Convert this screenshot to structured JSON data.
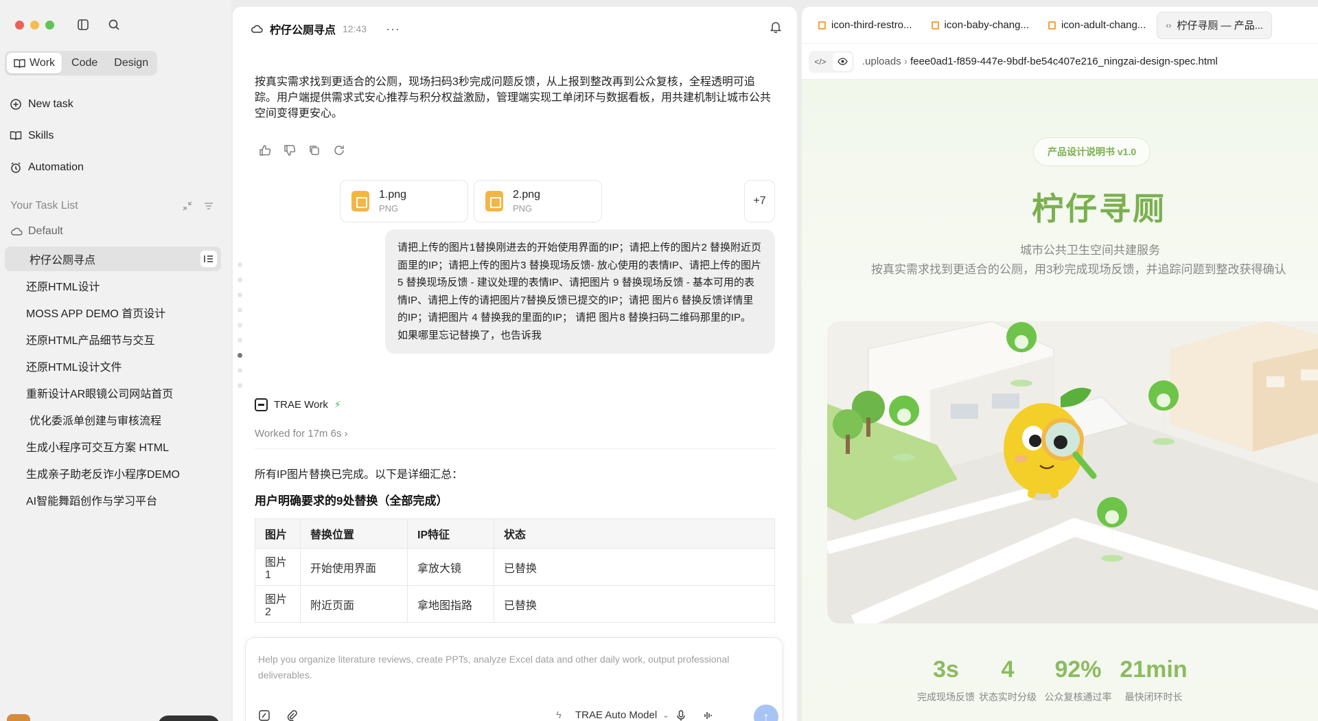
{
  "sidebar": {
    "modes": [
      "Work",
      "Code",
      "Design"
    ],
    "active_mode": "Work",
    "nav": {
      "new_task": "New task",
      "skills": "Skills",
      "automation": "Automation"
    },
    "tasklist_header": "Your Task List",
    "group": "Default",
    "tasks": [
      "柠仔公厕寻点",
      "还原HTML设计",
      "MOSS APP DEMO 首页设计",
      "还原HTML产品细节与交互",
      "还原HTML设计文件",
      "重新设计AR眼镜公司网站首页",
      "优化委派单创建与审核流程",
      "生成小程序可交互方案 HTML",
      "生成亲子助老反诈小程序DEMO",
      "AI智能舞蹈创作与学习平台"
    ]
  },
  "chat": {
    "title": "柠仔公厕寻点",
    "time": "12:43",
    "more": "···",
    "assistant_intro": "按真实需求找到更适合的公厕，现场扫码3秒完成问题反馈，从上报到整改再到公众复核，全程透明可追踪。用户端提供需求式安心推荐与积分权益激励，管理端实现工单闭环与数据看板，用共建机制让城市公共空间变得更安心。",
    "attachments": [
      {
        "name": "1.png",
        "type": "PNG"
      },
      {
        "name": "2.png",
        "type": "PNG"
      }
    ],
    "attachments_more": "+7",
    "user_message": "请把上传的图片1替换刚进去的开始使用界面的IP；请把上传的图片2 替换附近页面里的IP；请把上传的图片3 替换现场反馈- 放心使用的表情IP、请把上传的图片5 替换现场反馈 - 建议处理的表情IP、请把图片 9 替换现场反馈 - 基本可用的表情IP、请把上传的请把图片7替换反馈已提交的IP；请把 图片6 替换反馈详情里的IP；请把图片 4 替换我的里面的IP； 请把 图片8 替换扫码二维码那里的IP。 如果哪里忘记替换了，也告诉我",
    "agent_name": "TRAE Work",
    "worked_for": "Worked for 17m 6s",
    "summary": "所有IP图片替换已完成。以下是详细汇总：",
    "table_title": "用户明确要求的9处替换（全部完成）",
    "table": {
      "headers": [
        "图片",
        "替换位置",
        "IP特征",
        "状态"
      ],
      "rows": [
        [
          "图片1",
          "开始使用界面",
          "拿放大镜",
          "已替换"
        ],
        [
          "图片2",
          "附近页面",
          "拿地图指路",
          "已替换"
        ]
      ]
    },
    "input_placeholder": "Help you organize literature reviews, create PPTs, analyze Excel data and other daily work, output professional deliverables.",
    "model": "TRAE Auto Model"
  },
  "preview": {
    "tabs": [
      {
        "label": "icon-third-restro...",
        "icon": "image-file-icon"
      },
      {
        "label": "icon-baby-chang...",
        "icon": "image-file-icon"
      },
      {
        "label": "icon-adult-chang...",
        "icon": "image-file-icon"
      },
      {
        "label": "柠仔寻厕 — 产品...",
        "icon": "code-icon"
      }
    ],
    "path_root": ".uploads",
    "path_file": "feee0ad1-f859-447e-9bdf-be54c407e216_ningzai-design-spec.html",
    "badge": "产品设计说明书 v1.0",
    "hero_title": "柠仔寻厕",
    "hero_subtitle": "城市公共卫生空间共建服务",
    "hero_desc": "按真实需求找到更适合的公厕，用3秒完成现场反馈，并追踪问题到整改获得确认",
    "stats": [
      {
        "value": "3s",
        "label": "完成现场反馈"
      },
      {
        "value": "4",
        "label": "状态实时分级"
      },
      {
        "value": "92%",
        "label": "公众复核通过率"
      },
      {
        "value": "21min",
        "label": "最快闭环时长"
      }
    ],
    "colors": {
      "brand": "#7ab04e",
      "accent": "#f4c82a"
    }
  }
}
